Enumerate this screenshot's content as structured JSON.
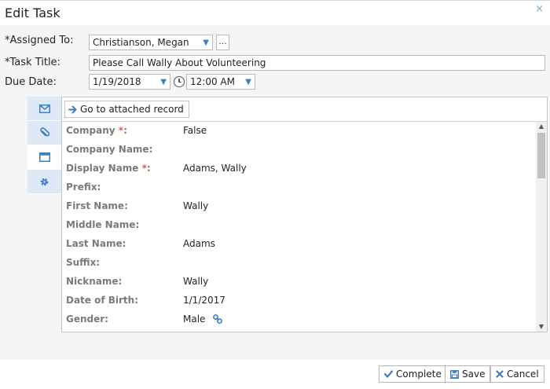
{
  "dialog": {
    "title": "Edit Task",
    "close_icon": "×"
  },
  "form": {
    "assigned_to_label": "*Assigned To:",
    "assigned_to_value": "Christianson, Megan",
    "assigned_to_more": "...",
    "task_title_label": "*Task Title:",
    "task_title_value": "Please Call Wally About Volunteering",
    "due_date_label": "Due Date:",
    "due_date_value": "1/19/2018",
    "due_time_value": "12:00 AM"
  },
  "side_tabs": [
    {
      "name": "envelope-icon"
    },
    {
      "name": "paperclip-icon"
    },
    {
      "name": "window-icon"
    },
    {
      "name": "gear-icon"
    }
  ],
  "panel": {
    "goto_label": "Go to attached record",
    "rows": [
      {
        "label": "Company",
        "required": true,
        "value": "False"
      },
      {
        "label": "Company Name:",
        "required": false,
        "value": ""
      },
      {
        "label": "Display Name",
        "required": true,
        "value": "Adams, Wally"
      },
      {
        "label": "Prefix:",
        "required": false,
        "value": ""
      },
      {
        "label": "First Name:",
        "required": false,
        "value": "Wally"
      },
      {
        "label": "Middle Name:",
        "required": false,
        "value": ""
      },
      {
        "label": "Last Name:",
        "required": false,
        "value": "Adams"
      },
      {
        "label": "Suffix:",
        "required": false,
        "value": ""
      },
      {
        "label": "Nickname:",
        "required": false,
        "value": "Wally"
      },
      {
        "label": "Date of Birth:",
        "required": false,
        "value": "1/1/2017"
      },
      {
        "label": "Gender:",
        "required": false,
        "value": "Male",
        "has_link": true
      }
    ]
  },
  "footer": {
    "complete_label": "Complete",
    "save_label": "Save",
    "cancel_label": "Cancel"
  },
  "colors": {
    "accent": "#3f7fc2",
    "required": "#e05a5a",
    "tab_bg": "#dde9f6",
    "body_bg": "#f4f5f7"
  }
}
